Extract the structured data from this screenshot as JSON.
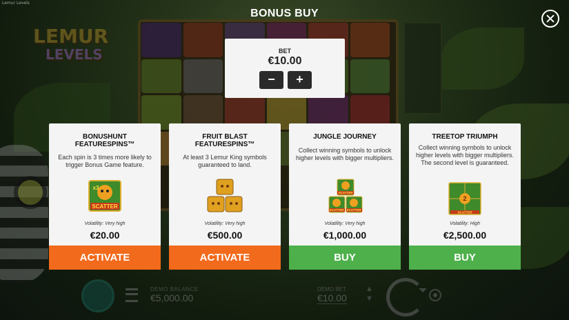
{
  "window": {
    "title": "Lemur Levels"
  },
  "logo": {
    "line1": "LEMUR",
    "line2": "LEVELS"
  },
  "overlay": {
    "title": "BONUS BUY",
    "close_icon": "close-icon"
  },
  "bet": {
    "label": "BET",
    "value": "€10.00",
    "decrease_label": "−",
    "increase_label": "+"
  },
  "cards": [
    {
      "title": "BONUSHUNT FEATURESPINS™",
      "description": "Each spin is 3 times more likely to trigger Bonus Game feature.",
      "volatility": "Volatility: Very high",
      "price": "€20.00",
      "button": "ACTIVATE",
      "button_color": "#f26a1b",
      "image_text": "SCATTER",
      "image_badge": "x3"
    },
    {
      "title": "FRUIT BLAST FEATURESPINS™",
      "description": "At least 3 Lemur King symbols guaranteed to land.",
      "volatility": "Volatility: Very high",
      "price": "€500.00",
      "button": "ACTIVATE",
      "button_color": "#f26a1b"
    },
    {
      "title": "JUNGLE JOURNEY",
      "description": "Collect winning symbols to unlock higher levels with bigger multipliers.",
      "volatility": "Volatility: Very high",
      "price": "€1,000.00",
      "button": "BUY",
      "button_color": "#4db04a",
      "image_text": "SCATTER"
    },
    {
      "title": "TREETOP TRIUMPH",
      "description": "Collect winning symbols to unlock higher levels with bigger multipliers. The second level is guaranteed.",
      "volatility": "Volatility: High",
      "price": "€2,500.00",
      "button": "BUY",
      "button_color": "#4db04a",
      "image_text": "SCATTER",
      "image_badge": "2"
    }
  ],
  "bottom_bar": {
    "balance_label": "DEMO BALANCE",
    "balance_value": "€5,000.00",
    "bet_label": "DEMO BET",
    "bet_value": "€10.00"
  }
}
